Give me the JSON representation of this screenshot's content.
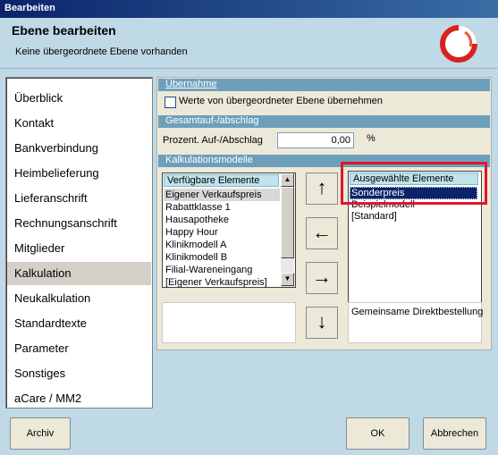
{
  "window": {
    "title": "Bearbeiten"
  },
  "header": {
    "title": "Ebene bearbeiten",
    "subtitle": "Keine übergeordnete Ebene vorhanden",
    "logo_icon": "red-o-logo-icon"
  },
  "sidebar": {
    "items": [
      {
        "label": "Überblick"
      },
      {
        "label": "Kontakt"
      },
      {
        "label": "Bankverbindung"
      },
      {
        "label": "Heimbelieferung"
      },
      {
        "label": "Lieferanschrift"
      },
      {
        "label": "Rechnungsanschrift"
      },
      {
        "label": "Mitglieder"
      },
      {
        "label": "Kalkulation"
      },
      {
        "label": "Neukalkulation"
      },
      {
        "label": "Standardtexte"
      },
      {
        "label": "Parameter"
      },
      {
        "label": "Sonstiges"
      },
      {
        "label": "aCare / MM2"
      }
    ],
    "active_index": 7
  },
  "sections": {
    "uebernahme": {
      "title": "Übernahme",
      "checkbox_label": "Werte von übergeordneter Ebene übernehmen",
      "checked": false
    },
    "gesamtauf": {
      "title": "Gesamtauf-/abschlag",
      "field_label": "Prozent. Auf-/Abschlag",
      "value": "0,00",
      "unit": "%"
    },
    "kalkulation": {
      "title": "Kalkulationsmodelle"
    }
  },
  "available": {
    "header": "Verfügbare Elemente",
    "items": [
      "Eigener Verkaufspreis",
      "Rabattklasse 1",
      "Hausapotheke",
      "Happy Hour",
      "Klinikmodell A",
      "Klinikmodell B",
      "Filial-Wareneingang",
      "[Eigener Verkaufspreis]"
    ]
  },
  "selected": {
    "header": "Ausgewählte Elemente",
    "items": [
      "Sonderpreis",
      "Beispielmodell",
      "[Standard]"
    ],
    "note": "Gemeinsame Direktbestellung"
  },
  "arrows": {
    "up": "↑",
    "left": "←",
    "right": "→",
    "down": "↓"
  },
  "buttons": {
    "archiv": "Archiv",
    "ok": "OK",
    "abbrechen": "Abbrechen"
  },
  "colors": {
    "highlight_box": "#e0172c",
    "section_header": "#6d9fbb",
    "selection": "#0a246a"
  }
}
